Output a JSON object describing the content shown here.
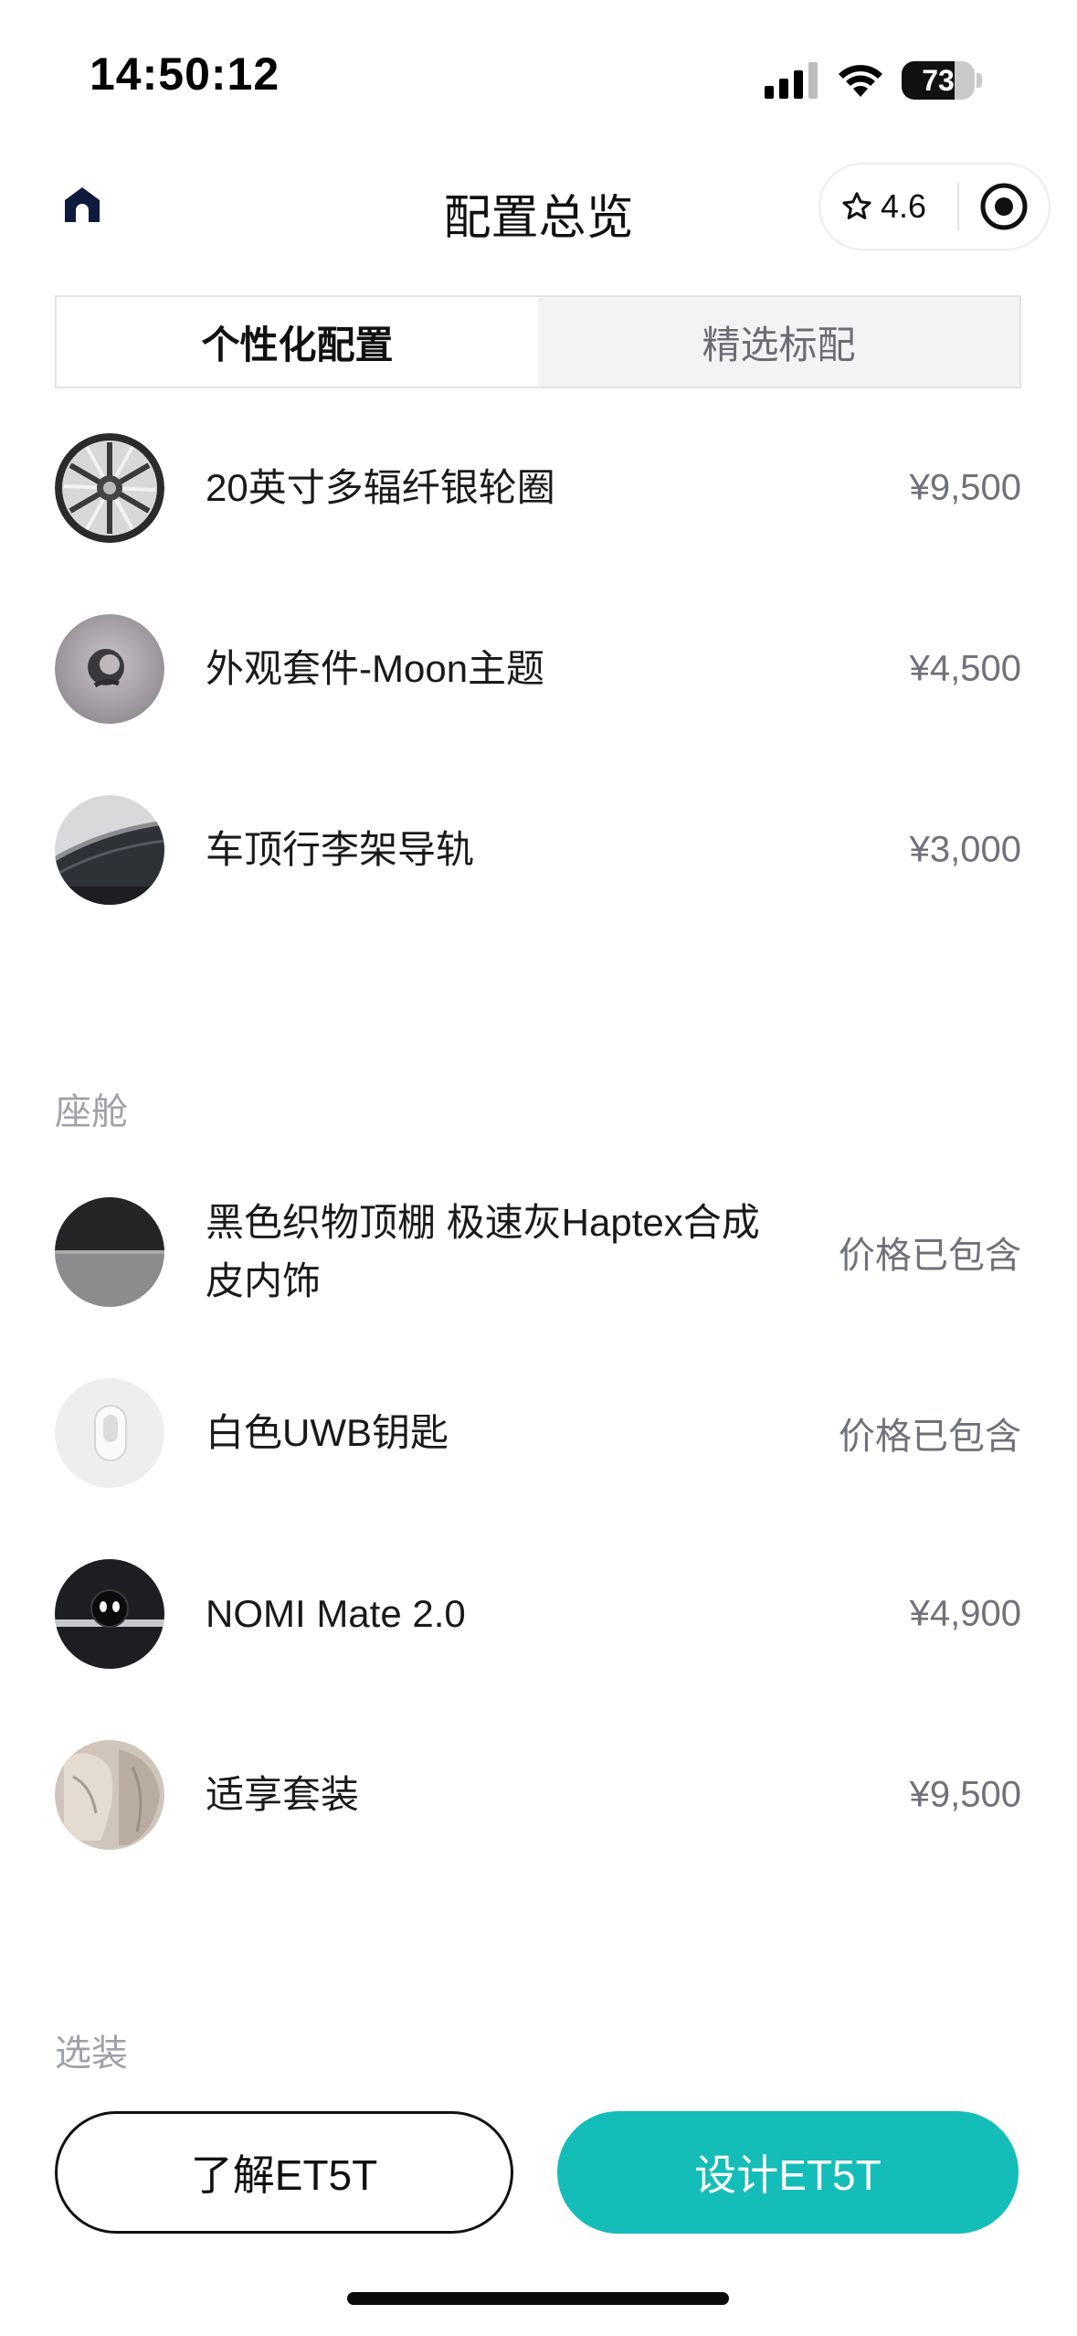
{
  "status_bar": {
    "time": "14:50:12",
    "battery": "73",
    "battery_level_percent": 73
  },
  "header": {
    "title": "配置总览",
    "rating": "4.6",
    "home_icon": "home-icon",
    "star_icon": "star-outline-icon",
    "target_icon": "target-icon"
  },
  "tabs": [
    {
      "label": "个性化配置",
      "active": true
    },
    {
      "label": "精选标配",
      "active": false
    }
  ],
  "exterior_items": [
    {
      "label": "20英寸多辐纤银轮圈",
      "price": "¥9,500",
      "thumb": "wheel-thumb"
    },
    {
      "label": "外观套件-Moon主题",
      "price": "¥4,500",
      "thumb": "moon-theme-thumb"
    },
    {
      "label": "车顶行李架导轨",
      "price": "¥3,000",
      "thumb": "roof-rail-thumb"
    }
  ],
  "cabin": {
    "title": "座舱",
    "items": [
      {
        "label": "黑色织物顶棚 极速灰Haptex合成皮内饰",
        "price": "价格已包含",
        "thumb": "interior-thumb"
      },
      {
        "label": "白色UWB钥匙",
        "price": "价格已包含",
        "thumb": "key-thumb"
      },
      {
        "label": "NOMI Mate 2.0",
        "price": "¥4,900",
        "thumb": "nomi-thumb"
      },
      {
        "label": "适享套装",
        "price": "¥9,500",
        "thumb": "seat-thumb"
      }
    ]
  },
  "options": {
    "title": "选装"
  },
  "buttons": {
    "learn": "了解ET5T",
    "design": "设计ET5T"
  },
  "colors": {
    "primary": "#14bdb8",
    "text": "#1a1a1a",
    "muted": "#6f727a",
    "section": "#9ea1a7"
  }
}
